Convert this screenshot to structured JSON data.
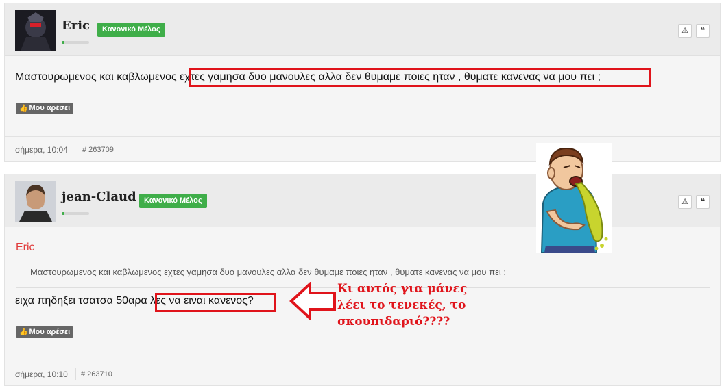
{
  "posts": [
    {
      "username": "Eric",
      "rank": "Κανονικό Μέλος",
      "text": "Μαστουρωμενος και καβλωμενος εχτες γαμησα δυο μανουλες αλλα δεν θυμαμε ποιες ηταν , θυματε κανενας να μου πει ;",
      "like_label": "Μου αρέσει",
      "date": "σήμερα, 10:04",
      "post_id": "# 263709"
    },
    {
      "username": "jean-Claud",
      "rank": "Κανονικό Μέλος",
      "quote_author": "Eric",
      "quote_text": "Μαστουρωμενος και καβλωμενος εχτες γαμησα δυο μανουλες αλλα δεν θυμαμε ποιες ηταν , θυματε κανενας να μου πει ;",
      "text": "ειχα πηδηξει τσατσα 50αρα λες να ειναι κανενος?",
      "like_label": "Μου αρέσει",
      "date": "σήμερα, 10:10",
      "post_id": "# 263710"
    }
  ],
  "tools": {
    "report_icon": "⚠",
    "quote_icon": "❝"
  },
  "annotation": {
    "line1": "Κι αυτός για μάνες",
    "line2": "λέει το τενεκές, το",
    "line3": "σκουπιδαριό????"
  },
  "colors": {
    "badge": "#3fae49",
    "highlight": "#e0141b",
    "quote_author": "#e03c3c"
  }
}
